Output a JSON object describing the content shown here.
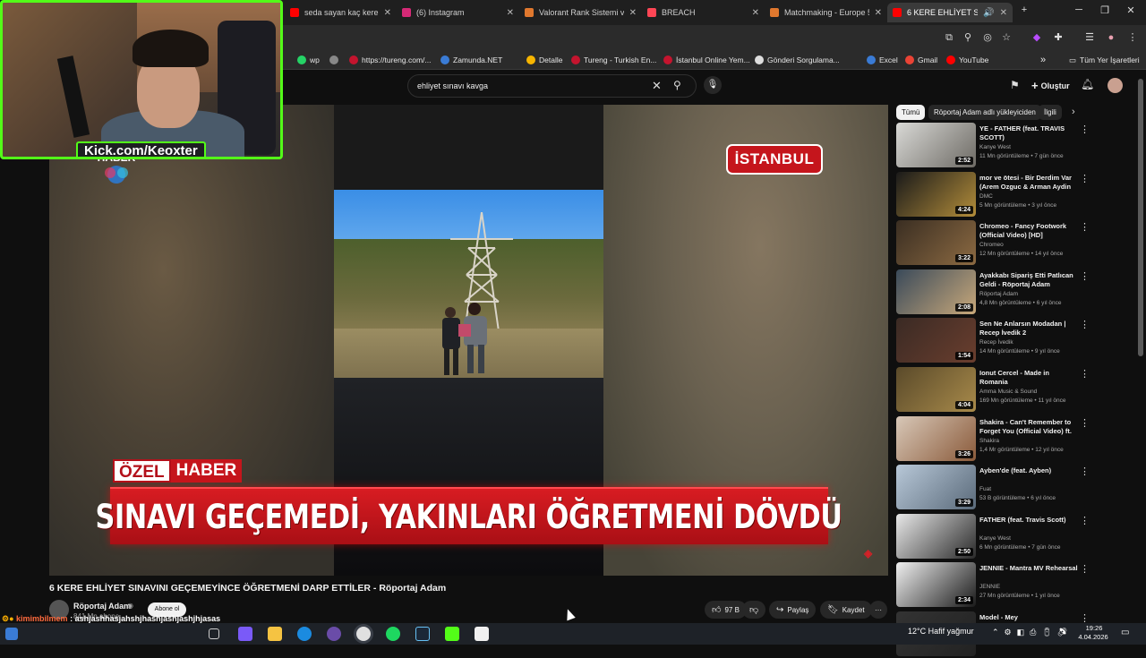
{
  "tabs": [
    {
      "label": "seda sayan kaç kere evlen",
      "color": "#ff0000",
      "active": false
    },
    {
      "label": "(6) Instagram",
      "color": "#d62976",
      "active": false
    },
    {
      "label": "Valorant Rank Sistemi ve",
      "color": "#e0782e",
      "active": false
    },
    {
      "label": "BREACH",
      "color": "#ff4655",
      "active": false
    },
    {
      "label": "Matchmaking - Europe 5",
      "color": "#e0782e",
      "active": false
    },
    {
      "label": "6 KERE EHLİYET SINA",
      "color": "#ff0000",
      "active": true
    }
  ],
  "toolbar": {
    "new_tab": "+",
    "minimize": "─",
    "restore": "❐",
    "close": "✕"
  },
  "bookmarks": [
    {
      "label": "wp",
      "color": "#25d366"
    },
    {
      "label": "",
      "color": "#888888"
    },
    {
      "label": "https://tureng.com/...",
      "color": "#c4142e"
    },
    {
      "label": "Zamunda.NET",
      "color": "#3a7bd5"
    },
    {
      "label": "Detalle",
      "color": "#f7b500"
    },
    {
      "label": "Tureng - Turkish En...",
      "color": "#c4142e"
    },
    {
      "label": "İstanbul Online Yem...",
      "color": "#c4142e"
    },
    {
      "label": "Gönderi Sorgulama...",
      "color": "#dddddd"
    },
    {
      "label": "Excel",
      "color": "#3a7bd5"
    },
    {
      "label": "Gmail",
      "color": "#ea4335"
    },
    {
      "label": "YouTube",
      "color": "#ff0000"
    }
  ],
  "bookmarks_overflow": "»",
  "all_bookmarks": "Tüm Yer İşaretleri",
  "search": {
    "query": "ehliyet sınavı kavga"
  },
  "header": {
    "create_label": "Oluştur"
  },
  "video": {
    "badge_city": "İSTANBUL",
    "ozel_a": "ÖZEL",
    "ozel_b": "HABER",
    "headline": "SINAVI GEÇEMEDİ, YAKINLARI ÖĞRETMENİ DÖVDÜ",
    "haber_logo": "HABER",
    "title": "6 KERE EHLİYET SINAVINI GEÇEMEYİNCE ÖĞRETMENİ DARP ETTİLER - Röportaj Adam",
    "channel": "Röportaj Adam",
    "subscribers": "841 Mn abone",
    "subscribe_label": "Abone ol",
    "likes": "97 B",
    "share_label": "Paylaş",
    "save_label": "Kaydet",
    "more_label": "···"
  },
  "streamer": {
    "kick_label": "Kick.com/Keoxter"
  },
  "chat": [
    {
      "user": "kimimbilmem",
      "message": ": ashjashhasjahshjhashjashjashjhjasas"
    },
    {
      "user": "melihberkay",
      "message": ""
    }
  ],
  "chips": [
    {
      "label": "Tümü",
      "active": true
    },
    {
      "label": "Röportaj Adam adlı yükleyiciden",
      "active": false
    },
    {
      "label": "İlgili",
      "active": false
    }
  ],
  "recommendations": [
    {
      "title": "YE - FATHER (feat. TRAVIS SCOTT)",
      "channel": "Kanye West",
      "meta": "11 Mn görüntüleme • 7 gün önce",
      "duration": "2:52",
      "c1": "#d9d9d6",
      "c2": "#6d6a64"
    },
    {
      "title": "mor ve ötesi - Bir Derdim Var (Arem Ozguc & Arman Aydin ...",
      "channel": "DMC",
      "meta": "5 Mn görüntüleme • 3 yıl önce",
      "duration": "4:24",
      "c1": "#1a1a1a",
      "c2": "#b38d3a"
    },
    {
      "title": "Chromeo - Fancy Footwork (Official Video) [HD]",
      "channel": "Chromeo",
      "meta": "12 Mn görüntüleme • 14 yıl önce",
      "duration": "3:22",
      "c1": "#3a2e22",
      "c2": "#8c6a42"
    },
    {
      "title": "Ayakkabı Sipariş Etti Patlıcan Geldi - Röportaj Adam",
      "channel": "Röportaj Adam",
      "meta": "4,8 Mn görüntüleme • 6 yıl önce",
      "duration": "2:08",
      "c1": "#3a4a5a",
      "c2": "#c8a87a"
    },
    {
      "title": "Sen Ne Anlarsın Modadan | Recep İvedik 2",
      "channel": "Recep İvedik",
      "meta": "14 Mn görüntüleme • 9 yıl önce",
      "duration": "1:54",
      "c1": "#3a2a24",
      "c2": "#6a3e2e"
    },
    {
      "title": "Ionut Cercel - Made in Romania",
      "channel": "Amma Music & Sound",
      "meta": "169 Mn görüntüleme • 11 yıl önce",
      "duration": "4:04",
      "c1": "#5a4a2a",
      "c2": "#a88a4a"
    },
    {
      "title": "Shakira - Can't Remember to Forget You (Official Video) ft. ...",
      "channel": "Shakira",
      "meta": "1,4 Mr görüntüleme • 12 yıl önce",
      "duration": "3:26",
      "c1": "#d8c8b8",
      "c2": "#8a5a3a"
    },
    {
      "title": "Ayben'de (feat. Ayben)",
      "channel": "Fuat",
      "meta": "53 B görüntüleme • 6 yıl önce",
      "duration": "3:29",
      "c1": "#b8c8d8",
      "c2": "#5a6a7a"
    },
    {
      "title": "FATHER (feat. Travis Scott)",
      "channel": "Kanye West",
      "meta": "6 Mn görüntüleme • 7 gün önce",
      "duration": "2:50",
      "c1": "#e8e8e8",
      "c2": "#2a2a2a"
    },
    {
      "title": "JENNIE - Mantra MV Rehearsal",
      "channel": "JENNIE",
      "meta": "27 Mn görüntüleme • 1 yıl önce",
      "duration": "2:34",
      "c1": "#f0f0f0",
      "c2": "#1a1a1a"
    },
    {
      "title": "Model - Mey",
      "channel": "",
      "meta": "",
      "duration": "",
      "c1": "#333333",
      "c2": "#222222"
    }
  ],
  "taskbar": {
    "weather": "12°C  Hafif yağmur",
    "time": "19:26",
    "date": "4.04.2026"
  }
}
